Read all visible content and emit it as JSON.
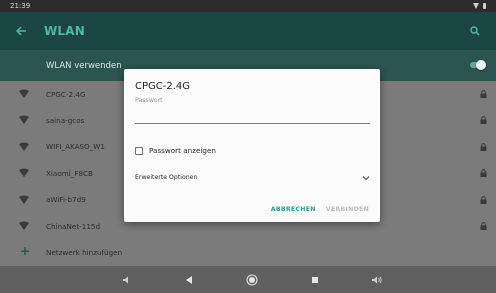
{
  "status": {
    "time": "21:39"
  },
  "appbar": {
    "title": "WLAN"
  },
  "toggle": {
    "label": "WLAN verwenden",
    "on": true
  },
  "networks": [
    {
      "ssid": "CPGC-2.4G",
      "locked": true
    },
    {
      "ssid": "saina-gcos",
      "locked": true
    },
    {
      "ssid": "WIFI_AKASO_W1",
      "locked": true
    },
    {
      "ssid": "Xiaomi_F8CB",
      "locked": true
    },
    {
      "ssid": "aWiFi-b7d9",
      "locked": true
    },
    {
      "ssid": "ChinaNet-115d",
      "locked": true
    }
  ],
  "add_network": {
    "label": "Netzwerk hinzufügen"
  },
  "dialog": {
    "title": "CPGC-2.4G",
    "password_label": "Passwort",
    "password_value": "",
    "show_password_label": "Passwort anzeigen",
    "advanced_label": "Erweiterte Optionen",
    "cancel_label": "ABBRECHEN",
    "connect_label": "VERBINDEN"
  },
  "colors": {
    "appbar": "#1a4643",
    "accent": "#2c9f8d",
    "toggle_row": "#2c5451"
  }
}
